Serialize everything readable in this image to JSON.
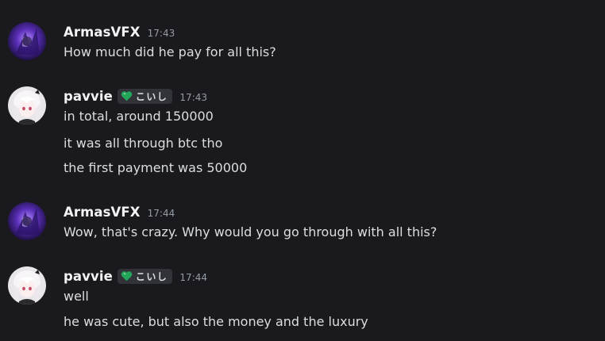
{
  "messages": [
    {
      "author": "ArmasVFX",
      "timestamp": "17:43",
      "avatar": "purple-avatar",
      "lines": [
        "How much did he pay for all this?"
      ]
    },
    {
      "author": "pavvie",
      "tag": "こいし",
      "tag_icon": "green-heart-icon",
      "timestamp": "17:43",
      "avatar": "white-hair-avatar",
      "lines": [
        "in total, around 150000",
        "it was all through btc tho",
        "the first payment was 50000"
      ]
    },
    {
      "author": "ArmasVFX",
      "timestamp": "17:44",
      "avatar": "purple-avatar",
      "lines": [
        "Wow, that's crazy. Why would you go through with all this?"
      ]
    },
    {
      "author": "pavvie",
      "tag": "こいし",
      "tag_icon": "green-heart-icon",
      "timestamp": "17:44",
      "avatar": "white-hair-avatar",
      "lines": [
        "well",
        "he was cute, but also the money and the luxury"
      ]
    }
  ],
  "colors": {
    "background": "#1a1a1e",
    "username": "#f2f3f5",
    "message_text": "#dbdee1",
    "timestamp": "#949ba4",
    "tag_background": "#313338",
    "heart": "#23a55a"
  }
}
